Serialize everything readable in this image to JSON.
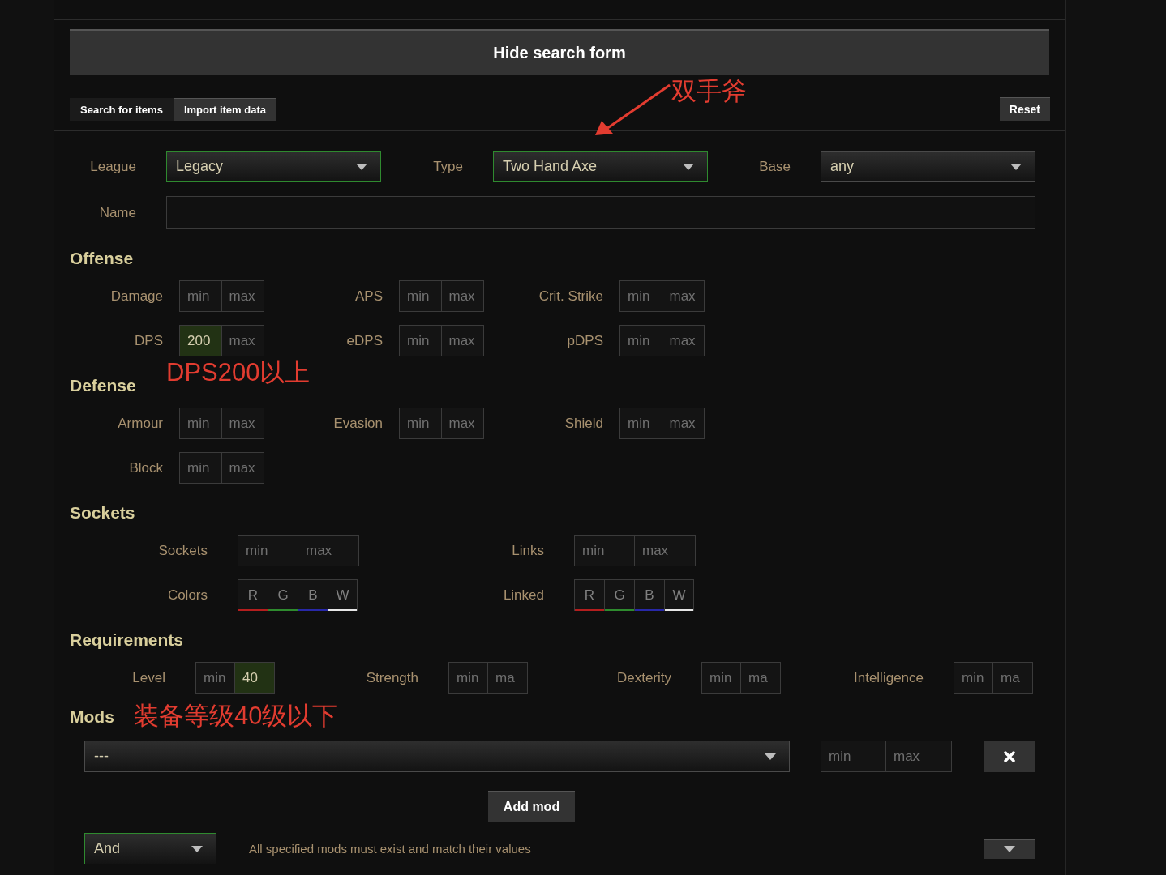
{
  "toggle_button": "Hide search form",
  "tabs": [
    {
      "label": "Search for items",
      "selected": true
    },
    {
      "label": "Import item data",
      "selected": false
    }
  ],
  "reset_button": "Reset",
  "selects": [
    {
      "label": "League",
      "value": "Legacy",
      "highlighted": true
    },
    {
      "label": "Type",
      "value": "Two Hand Axe",
      "highlighted": true
    },
    {
      "label": "Base",
      "value": "any",
      "highlighted": false
    }
  ],
  "name_field": {
    "label": "Name"
  },
  "sections": [
    {
      "title": "Offense",
      "rows": [
        {
          "fields": [
            {
              "kind": "range",
              "label": "Damage",
              "min": {
                "placeholder": "min"
              },
              "max": {
                "placeholder": "max"
              }
            },
            {
              "kind": "range",
              "label": "APS",
              "min": {
                "placeholder": "min"
              },
              "max": {
                "placeholder": "max"
              }
            },
            {
              "kind": "range",
              "label": "Crit. Strike",
              "min": {
                "placeholder": "min"
              },
              "max": {
                "placeholder": "max"
              }
            }
          ]
        },
        {
          "fields": [
            {
              "kind": "range",
              "label": "DPS",
              "min": {
                "value": "200"
              },
              "max": {
                "placeholder": "max"
              }
            },
            {
              "kind": "range",
              "label": "eDPS",
              "min": {
                "placeholder": "min"
              },
              "max": {
                "placeholder": "max"
              }
            },
            {
              "kind": "range",
              "label": "pDPS",
              "min": {
                "placeholder": "min"
              },
              "max": {
                "placeholder": "max"
              }
            }
          ]
        }
      ]
    },
    {
      "title": "Defense",
      "rows": [
        {
          "fields": [
            {
              "kind": "range",
              "label": "Armour",
              "min": {
                "placeholder": "min"
              },
              "max": {
                "placeholder": "max"
              }
            },
            {
              "kind": "range",
              "label": "Evasion",
              "min": {
                "placeholder": "min"
              },
              "max": {
                "placeholder": "max"
              }
            },
            {
              "kind": "range",
              "label": "Shield",
              "min": {
                "placeholder": "min"
              },
              "max": {
                "placeholder": "max"
              }
            }
          ]
        },
        {
          "fields": [
            {
              "kind": "range",
              "label": "Block",
              "min": {
                "placeholder": "min"
              },
              "max": {
                "placeholder": "max"
              }
            }
          ]
        }
      ]
    },
    {
      "title": "Sockets",
      "rows": [
        {
          "fields": [
            {
              "kind": "range",
              "label": "Sockets",
              "min": {
                "placeholder": "min"
              },
              "max": {
                "placeholder": "max"
              }
            },
            {
              "kind": "range",
              "label": "Links",
              "min": {
                "placeholder": "min"
              },
              "max": {
                "placeholder": "max"
              }
            }
          ]
        },
        {
          "fields": [
            {
              "kind": "sockets",
              "label": "Colors",
              "sockets": [
                {
                  "letter": "R",
                  "color": "#b41e1e"
                },
                {
                  "letter": "G",
                  "color": "#2e8b2e"
                },
                {
                  "letter": "B",
                  "color": "#2828a8"
                },
                {
                  "letter": "W",
                  "color": "#e6e6e6"
                }
              ]
            },
            {
              "kind": "sockets",
              "label": "Linked",
              "sockets": [
                {
                  "letter": "R",
                  "color": "#b41e1e"
                },
                {
                  "letter": "G",
                  "color": "#2e8b2e"
                },
                {
                  "letter": "B",
                  "color": "#2828a8"
                },
                {
                  "letter": "W",
                  "color": "#e6e6e6"
                }
              ]
            }
          ]
        }
      ]
    },
    {
      "title": "Requirements",
      "rows": [
        {
          "fields": [
            {
              "kind": "range",
              "label": "Level",
              "min": {
                "placeholder": "min"
              },
              "max": {
                "value": "40"
              }
            },
            {
              "kind": "range",
              "label": "Strength",
              "min": {
                "placeholder": "min"
              },
              "max": {
                "placeholder": "ma"
              }
            },
            {
              "kind": "range",
              "label": "Dexterity",
              "min": {
                "placeholder": "min"
              },
              "max": {
                "placeholder": "ma"
              }
            },
            {
              "kind": "range",
              "label": "Intelligence",
              "min": {
                "placeholder": "min"
              },
              "max": {
                "placeholder": "ma"
              }
            }
          ]
        }
      ]
    }
  ],
  "mods": {
    "title": "Mods",
    "rows": [
      {
        "value": "---",
        "min": {
          "placeholder": "min"
        },
        "max": {
          "placeholder": "max"
        }
      }
    ],
    "add_button": "Add mod"
  },
  "mod_group": {
    "operator": "And",
    "description": "All specified mods must exist and match their values"
  },
  "annotations": [
    {
      "text": "双手斧"
    },
    {
      "text": "DPS200以上"
    },
    {
      "text": "装备等级40级以下"
    }
  ]
}
